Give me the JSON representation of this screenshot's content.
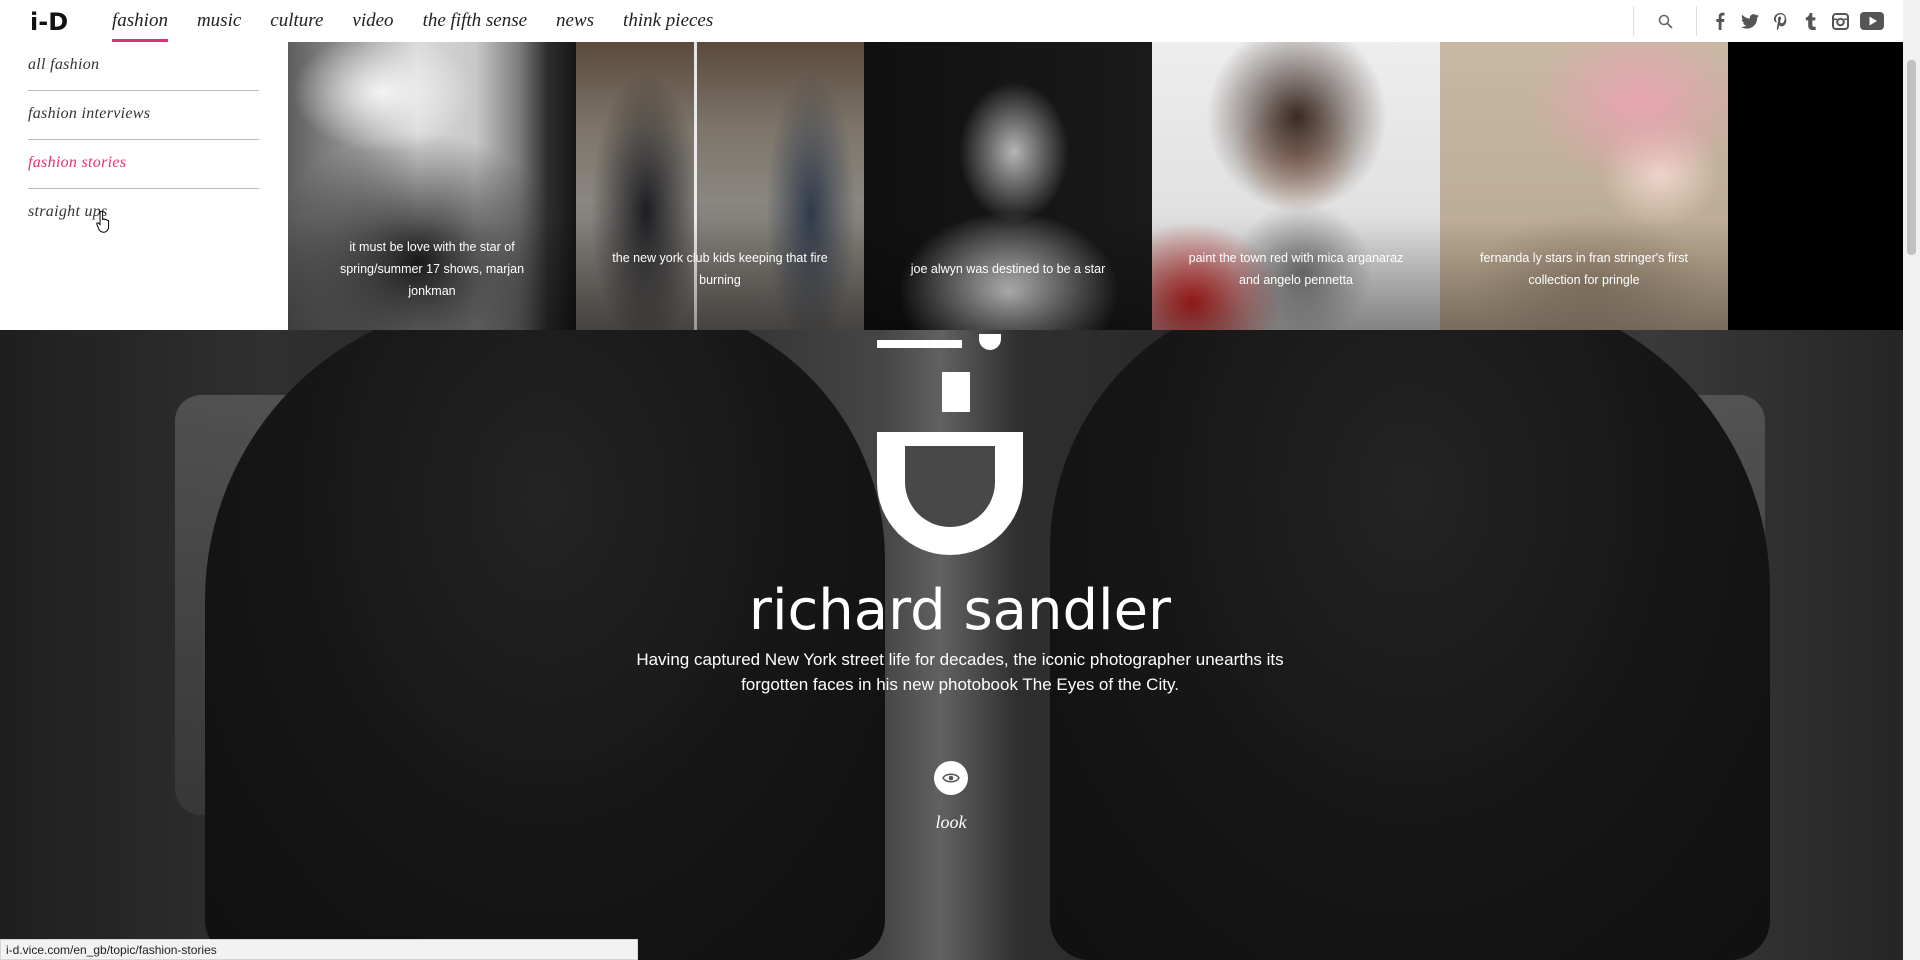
{
  "nav": {
    "logo": "i-D",
    "items": [
      {
        "label": "fashion",
        "active": true
      },
      {
        "label": "music"
      },
      {
        "label": "culture"
      },
      {
        "label": "video"
      },
      {
        "label": "the fifth sense"
      },
      {
        "label": "news"
      },
      {
        "label": "think pieces"
      }
    ],
    "icons": [
      "search-icon",
      "facebook-icon",
      "twitter-icon",
      "pinterest-icon",
      "tumblr-icon",
      "instagram-icon",
      "youtube-icon"
    ]
  },
  "dropdown": {
    "submenu": [
      {
        "label": "all fashion"
      },
      {
        "label": "fashion interviews"
      },
      {
        "label": "fashion stories",
        "hover": true
      },
      {
        "label": "straight ups"
      }
    ],
    "cards": [
      {
        "caption": "it must be love with the star of spring/summer 17 shows, marjan jonkman"
      },
      {
        "caption": "the new york club kids keeping that fire burning"
      },
      {
        "caption": "joe alwyn was destined to be a star"
      },
      {
        "caption": "paint the town red with mica arganaraz and angelo pennetta"
      },
      {
        "caption": "fernanda ly stars in fran stringer's first collection for pringle"
      }
    ]
  },
  "hero": {
    "title": "richard sandler",
    "description": "Having captured New York street life for decades, the iconic photographer unearths its forgotten faces in his new photobook The Eyes of the City.",
    "cta_label": "look"
  },
  "status_url": "i-d.vice.com/en_gb/topic/fashion-stories",
  "colors": {
    "accent": "#e2336b"
  }
}
